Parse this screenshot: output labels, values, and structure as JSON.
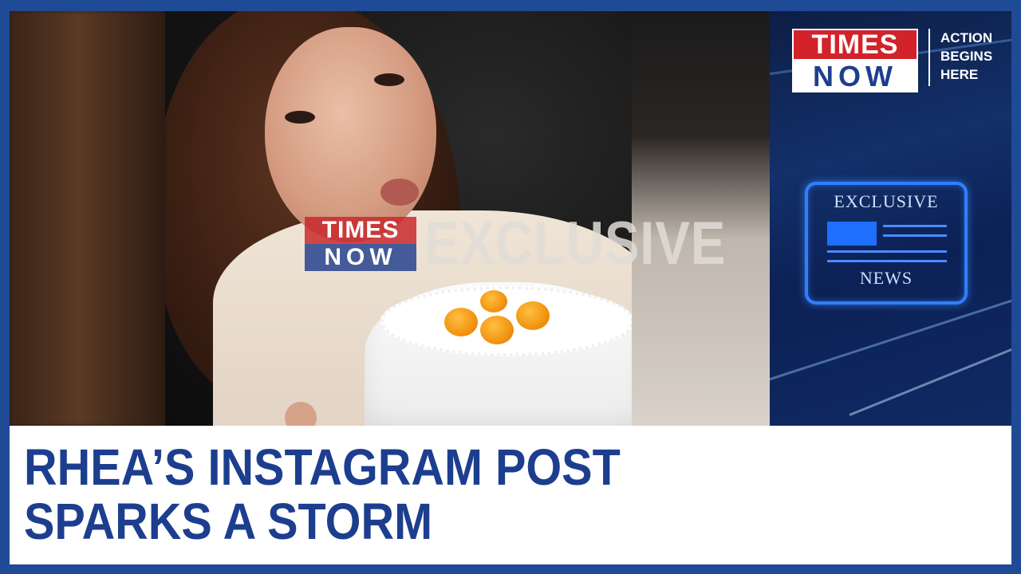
{
  "brand": {
    "logo_top": "TIMES",
    "logo_bottom": "NOW",
    "tagline_lines": [
      "ACTION",
      "BEGINS",
      "HERE"
    ]
  },
  "watermark": {
    "logo_top": "TIMES",
    "logo_bottom": "NOW",
    "text": "EXCLUSIVE"
  },
  "badge": {
    "top": "EXCLUSIVE",
    "bottom": "NEWS"
  },
  "headline": {
    "line1": "RHEA’S INSTAGRAM POST",
    "line2": "SPARKS A STORM"
  },
  "colors": {
    "frame": "#1f4a96",
    "headline": "#1d3e8f",
    "logo_red": "#d2232a",
    "badge_blue": "#2f7fff"
  }
}
